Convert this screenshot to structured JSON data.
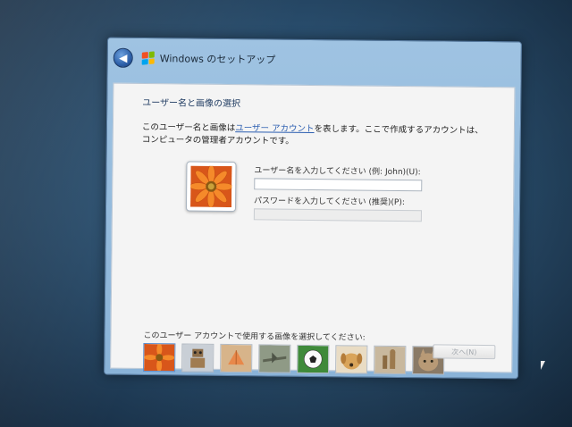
{
  "window": {
    "title": "Windows のセットアップ"
  },
  "page": {
    "heading": "ユーザー名と画像の選択",
    "desc_before_link": "このユーザー名と画像は",
    "desc_link": "ユーザー アカウント",
    "desc_after_link": "を表します。ここで作成するアカウントは、コンピュータの管理者アカウントです。"
  },
  "form": {
    "username_label": "ユーザー名を入力してください (例: John)(U):",
    "username_value": "",
    "password_label": "パスワードを入力してください (推奨)(P):",
    "password_value": ""
  },
  "pictures": {
    "label": "このユーザー アカウントで使用する画像を選択してください:",
    "items": [
      {
        "name": "flower",
        "selected": true
      },
      {
        "name": "robot",
        "selected": false
      },
      {
        "name": "shell",
        "selected": false
      },
      {
        "name": "airplane",
        "selected": false
      },
      {
        "name": "soccer-ball",
        "selected": false
      },
      {
        "name": "dog",
        "selected": false
      },
      {
        "name": "chess",
        "selected": false
      },
      {
        "name": "cat",
        "selected": false
      }
    ]
  },
  "buttons": {
    "next_label": "次へ(N)"
  },
  "icons": {
    "back": "back-arrow-icon",
    "app": "windows-logo-icon",
    "cursor": "mouse-cursor-icon"
  },
  "colors": {
    "win_red": "#f25022",
    "win_green": "#7fba00",
    "win_blue": "#00a4ef",
    "win_yellow": "#ffb900",
    "link": "#2a5db0",
    "flower": "#f07a1e"
  }
}
